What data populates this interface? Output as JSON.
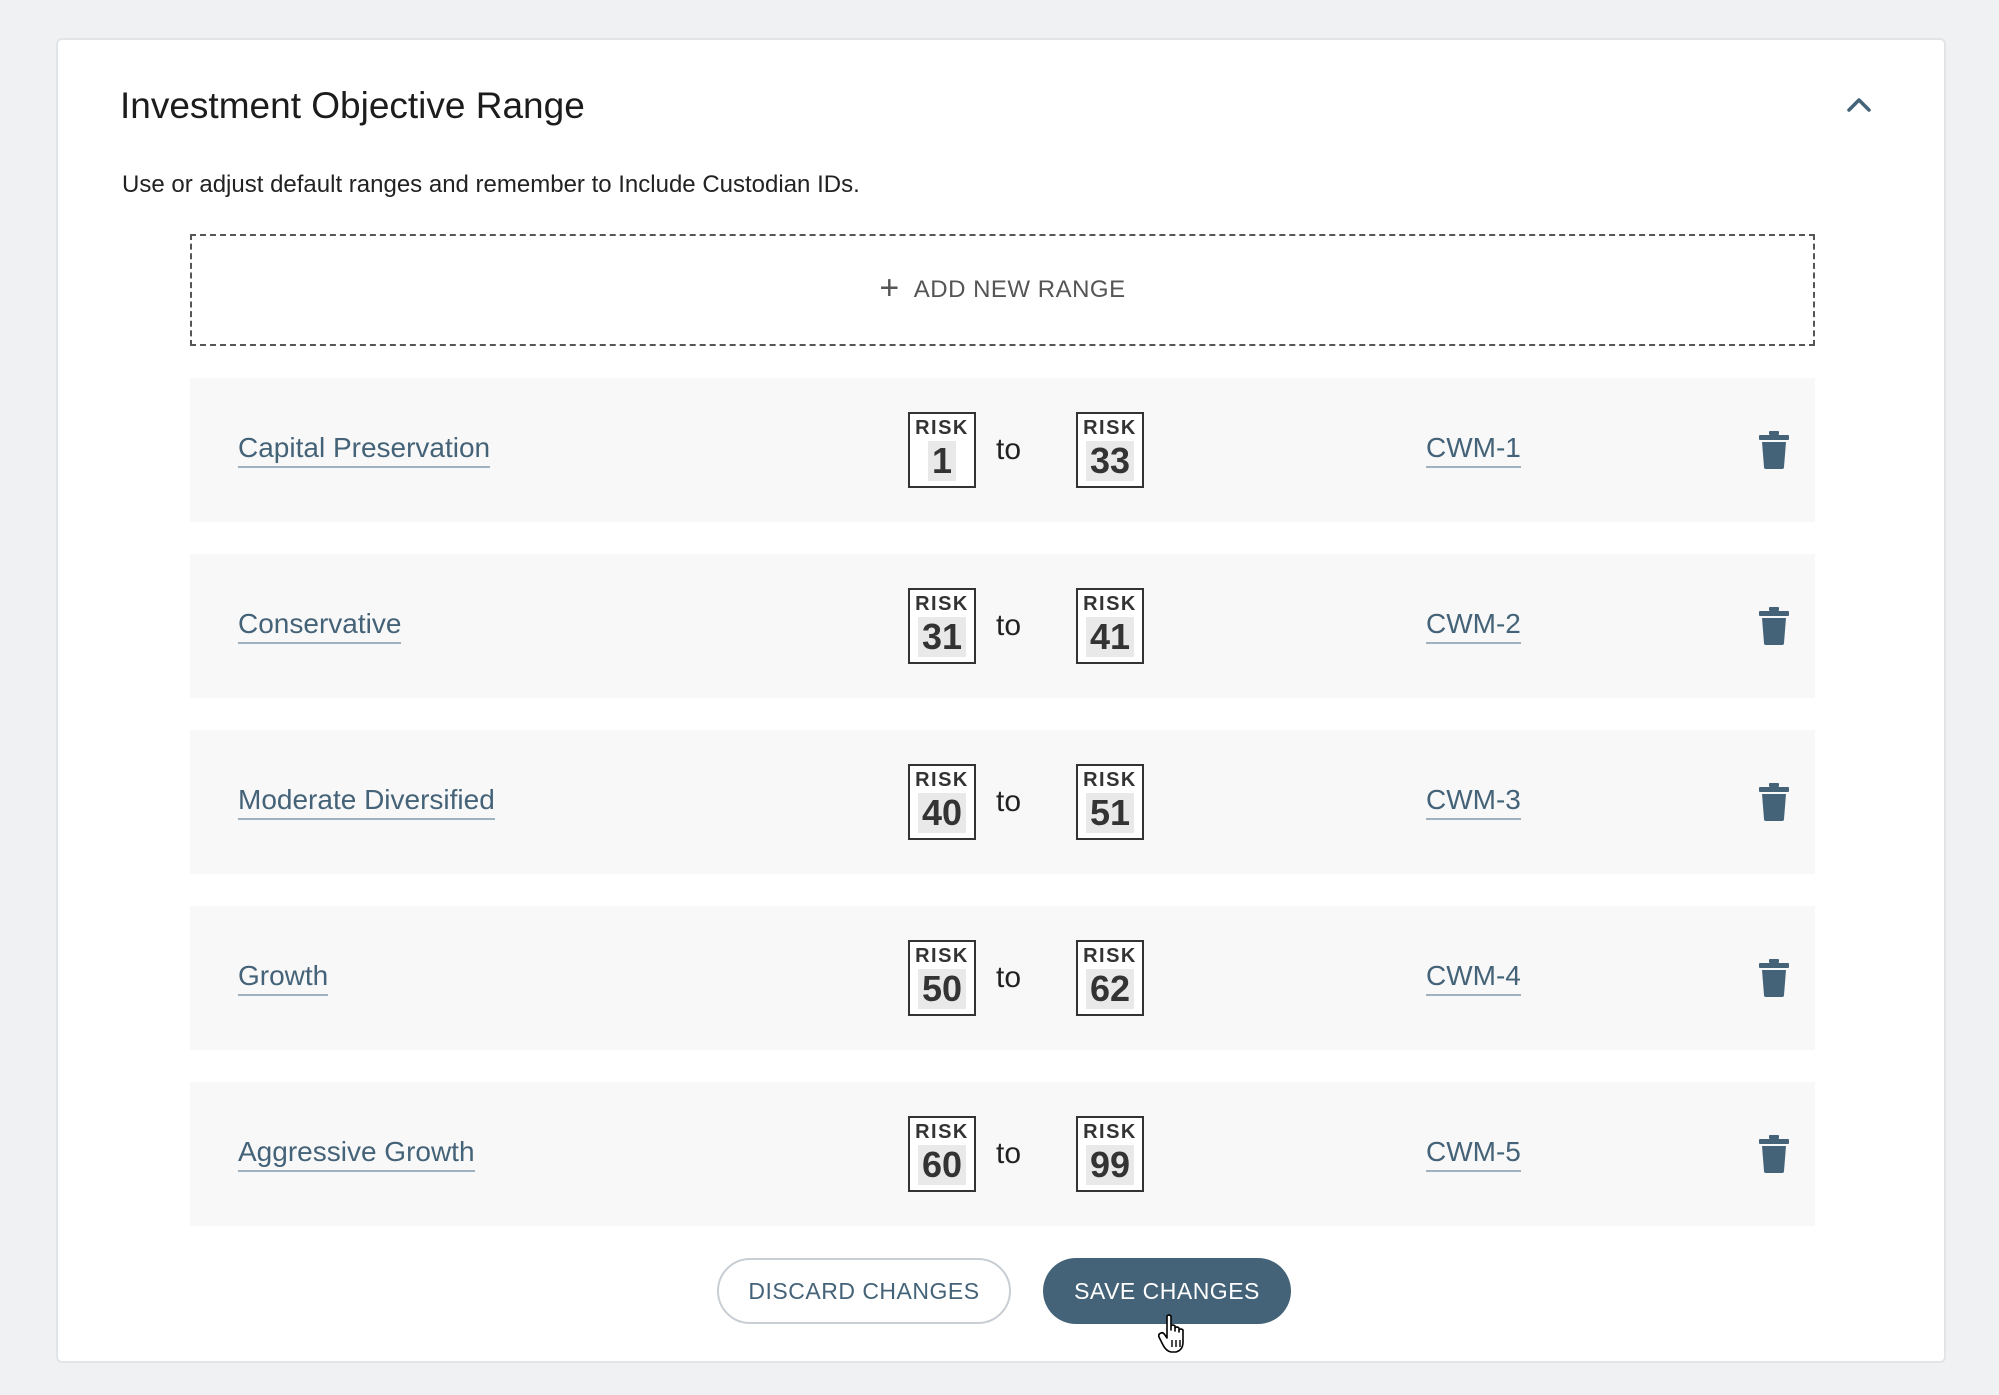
{
  "panel": {
    "title": "Investment Objective Range",
    "description": "Use or adjust default ranges and remember to Include Custodian IDs.",
    "collapse_icon": "chevron-up-icon"
  },
  "add_range": {
    "label": "ADD NEW RANGE",
    "icon": "plus-icon"
  },
  "risk_label": "RISK",
  "to_label": "to",
  "ranges": [
    {
      "name": "Capital Preservation",
      "from": "1",
      "to": "33",
      "id": "CWM-1"
    },
    {
      "name": "Conservative",
      "from": "31",
      "to": "41",
      "id": "CWM-2"
    },
    {
      "name": "Moderate Diversified",
      "from": "40",
      "to": "51",
      "id": "CWM-3"
    },
    {
      "name": "Growth",
      "from": "50",
      "to": "62",
      "id": "CWM-4"
    },
    {
      "name": "Aggressive Growth",
      "from": "60",
      "to": "99",
      "id": "CWM-5"
    }
  ],
  "actions": {
    "discard_label": "DISCARD CHANGES",
    "save_label": "SAVE CHANGES"
  },
  "colors": {
    "accent": "#456378",
    "background": "#eff1f3",
    "row_background": "#f8f8f8"
  }
}
